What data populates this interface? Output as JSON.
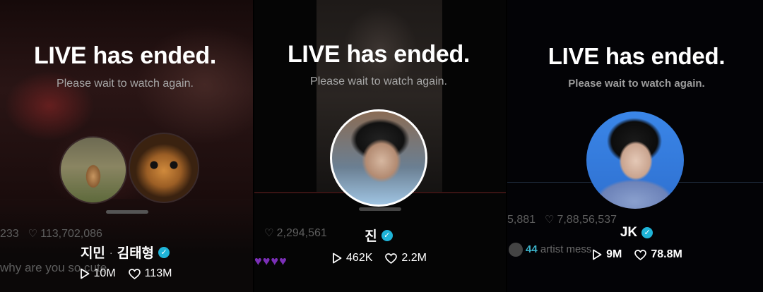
{
  "panels": [
    {
      "title": "LIVE has ended.",
      "subtitle": "Please wait to watch again.",
      "behind_stats": {
        "left": "233",
        "hearts": "113,702,086"
      },
      "behind_comment": "why are you so cute",
      "name_1": "지민",
      "separator": "·",
      "name_2": "김태형",
      "views": "10M",
      "likes": "113M"
    },
    {
      "title": "LIVE has ended.",
      "subtitle": "Please wait to watch again.",
      "behind_stats": {
        "hearts": "2,294,561"
      },
      "name": "진",
      "views": "462K",
      "likes": "2.2M"
    },
    {
      "title": "LIVE has ended.",
      "subtitle": "Please wait to watch again.",
      "behind_stats": {
        "left": "5,881",
        "hearts": "7,88,56,537"
      },
      "behind_message_count": "44",
      "behind_message_text": "artist mess",
      "name": "JK",
      "views": "9M",
      "likes": "78.8M"
    }
  ],
  "icons": {
    "play": "play-icon",
    "heart": "heart-icon",
    "verified": "verified-badge-icon"
  },
  "colors": {
    "verified": "#1fb4d8",
    "subtitle": "#a7a7a7",
    "message_count": "#3bb0c8"
  }
}
